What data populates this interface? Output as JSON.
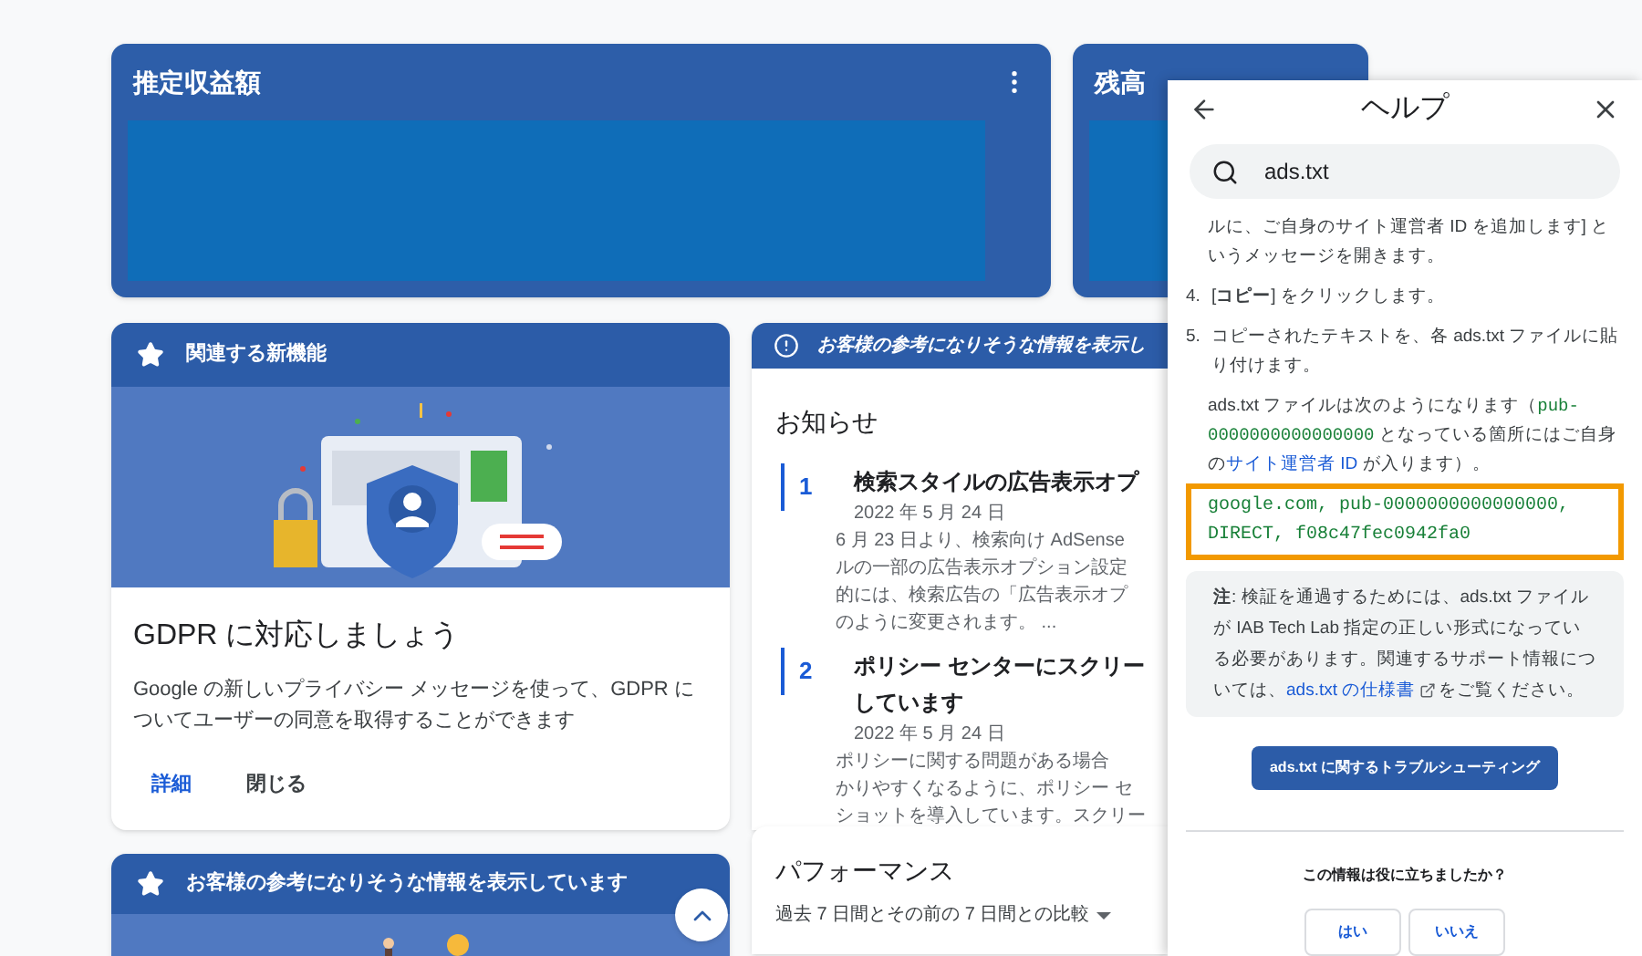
{
  "top_cards": [
    {
      "title": "推定収益額",
      "has_menu": true
    },
    {
      "title": "残高",
      "has_menu": false
    }
  ],
  "feature_card": {
    "header": "関連する新機能",
    "title": "GDPR に対応しましょう",
    "description": "Google の新しいプライバシー メッセージを使って、GDPR についてユーザーの同意を取得することができます",
    "actions": [
      {
        "label": "詳細",
        "primary": true
      },
      {
        "label": "閉じる",
        "primary": false
      }
    ]
  },
  "insight_card": {
    "header": "お客様の参考になりそうな情報を表示しています"
  },
  "notices_card": {
    "header": "お客様の参考になりそうな情報を表示し",
    "title": "お知らせ",
    "items": [
      {
        "number": "1",
        "title_lines": [
          "検索スタイルの広告表示オプ"
        ],
        "date": "2022 年 5 月 24 日",
        "body_lines": [
          "6 月 23 日より、検索向け AdSense",
          "ルの一部の広告表示オプション設定",
          "的には、検索広告の「広告表示オプ",
          "のように変更されます。 ..."
        ]
      },
      {
        "number": "2",
        "title_lines": [
          "ポリシー センターにスクリー",
          "しています"
        ],
        "date": "2022 年 5 月 24 日",
        "body_lines": [
          "ポリシーに関する問題がある場合",
          "かりやすくなるように、ポリシー セ",
          "ショットを導入しています。スクリー"
        ]
      }
    ]
  },
  "performance_card": {
    "title": "パフォーマンス",
    "comparison": "過去 7 日間とその前の 7 日間との比較"
  },
  "help_panel": {
    "title": "ヘルプ",
    "search": {
      "value": "ads.txt"
    },
    "content": [
      {
        "kind": "paragraph",
        "segments": [
          {
            "kind": "text",
            "text": "ルに、ご自身のサイト運営者 ID を追加します] というメッセージを開きます。"
          }
        ]
      },
      {
        "kind": "step",
        "number": "4.",
        "segments": [
          {
            "kind": "text",
            "text": "[**コピー**] をクリックします。"
          }
        ]
      },
      {
        "kind": "step",
        "number": "5.",
        "segments": [
          {
            "kind": "text",
            "text": "コピーされたテキストを、各 ads.txt ファイルに貼り付けます。"
          }
        ]
      },
      {
        "kind": "paragraph",
        "segments": [
          {
            "kind": "text",
            "text": "ads.txt ファイルは次のようになります（"
          },
          {
            "kind": "code",
            "text": "pub-0000000000000000"
          },
          {
            "kind": "text",
            "text": " となっている箇所にはご自身の"
          },
          {
            "kind": "link",
            "text": "サイト運営者 ID"
          },
          {
            "kind": "text",
            "text": " が入ります）。"
          }
        ]
      },
      {
        "kind": "code",
        "text": "google.com, pub-0000000000000000, DIRECT, f08c47fec0942fa0"
      },
      {
        "kind": "note",
        "segments": [
          {
            "kind": "text",
            "text": "**注**: 検証を通過するためには、ads.txt ファイルが IAB Tech Lab 指定の正しい形式になっている必要があります。関連するサポート情報については、"
          },
          {
            "kind": "link",
            "text": "ads.txt の仕様書"
          },
          {
            "kind": "text",
            "text": "をご覧ください。"
          }
        ]
      }
    ],
    "troubleshoot_button": "ads.txt に関するトラブルシューティング",
    "feedback": {
      "question": "この情報は役に立ちましたか？",
      "buttons": [
        "はい",
        "いいえ"
      ]
    }
  }
}
